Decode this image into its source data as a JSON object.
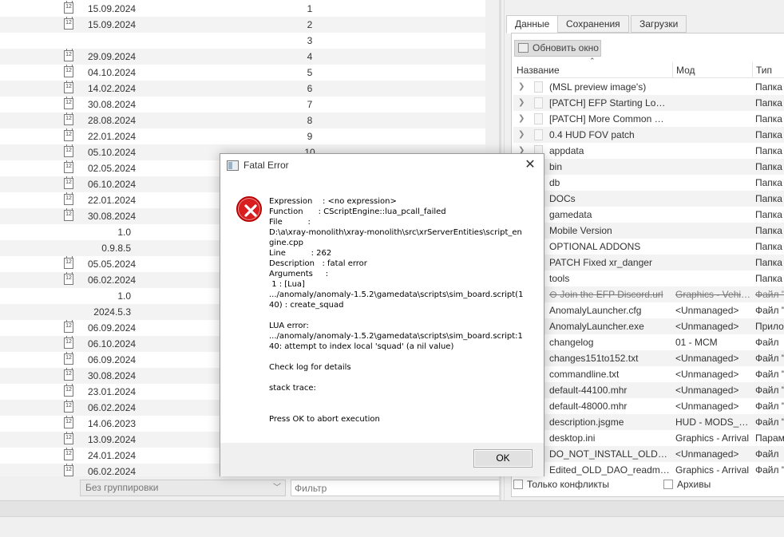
{
  "left_list": {
    "rows": [
      {
        "icon": true,
        "date": "15.09.2024",
        "version": "",
        "num": "1"
      },
      {
        "icon": true,
        "date": "15.09.2024",
        "version": "",
        "num": "2"
      },
      {
        "icon": false,
        "date": "",
        "version": "",
        "num": "3"
      },
      {
        "icon": true,
        "date": "29.09.2024",
        "version": "",
        "num": "4"
      },
      {
        "icon": true,
        "date": "04.10.2024",
        "version": "",
        "num": "5"
      },
      {
        "icon": true,
        "date": "14.02.2024",
        "version": "",
        "num": "6"
      },
      {
        "icon": true,
        "date": "30.08.2024",
        "version": "",
        "num": "7"
      },
      {
        "icon": true,
        "date": "28.08.2024",
        "version": "",
        "num": "8"
      },
      {
        "icon": true,
        "date": "22.01.2024",
        "version": "",
        "num": "9"
      },
      {
        "icon": true,
        "date": "05.10.2024",
        "version": "",
        "num": "10"
      },
      {
        "icon": true,
        "date": "02.05.2024",
        "version": "",
        "num": ""
      },
      {
        "icon": true,
        "date": "06.10.2024",
        "version": "",
        "num": ""
      },
      {
        "icon": true,
        "date": "22.01.2024",
        "version": "",
        "num": ""
      },
      {
        "icon": true,
        "date": "30.08.2024",
        "version": "",
        "num": ""
      },
      {
        "icon": false,
        "date": "",
        "version": "1.0",
        "num": ""
      },
      {
        "icon": false,
        "date": "",
        "version": "0.9.8.5",
        "num": ""
      },
      {
        "icon": true,
        "date": "05.05.2024",
        "version": "",
        "num": ""
      },
      {
        "icon": true,
        "date": "06.02.2024",
        "version": "",
        "num": ""
      },
      {
        "icon": false,
        "date": "",
        "version": "1.0",
        "num": ""
      },
      {
        "icon": false,
        "date": "",
        "version": "2024.5.3",
        "num": ""
      },
      {
        "icon": true,
        "date": "06.09.2024",
        "version": "",
        "num": ""
      },
      {
        "icon": true,
        "date": "06.10.2024",
        "version": "",
        "num": ""
      },
      {
        "icon": true,
        "date": "06.09.2024",
        "version": "",
        "num": ""
      },
      {
        "icon": true,
        "date": "30.08.2024",
        "version": "",
        "num": ""
      },
      {
        "icon": true,
        "date": "23.01.2024",
        "version": "",
        "num": ""
      },
      {
        "icon": true,
        "date": "06.02.2024",
        "version": "",
        "num": ""
      },
      {
        "icon": true,
        "date": "14.06.2023",
        "version": "",
        "num": ""
      },
      {
        "icon": true,
        "date": "13.09.2024",
        "version": "",
        "num": ""
      },
      {
        "icon": true,
        "date": "24.01.2024",
        "version": "",
        "num": ""
      },
      {
        "icon": true,
        "date": "06.02.2024",
        "version": "",
        "num": ""
      }
    ],
    "calendar_icon_text": "12",
    "grouping_value": "Без группировки",
    "filter_placeholder": "Фильтр"
  },
  "right_pane": {
    "tabs": [
      "Данные",
      "Сохранения",
      "Загрузки"
    ],
    "refresh_label": "Обновить окно",
    "columns": [
      "Название",
      "Мод",
      "Тип"
    ],
    "rows": [
      {
        "expandable": true,
        "name": "(MSL preview image's)",
        "mod": "",
        "type": "Папка",
        "strike": false
      },
      {
        "expandable": true,
        "name": "[PATCH] EFP Starting Loadouts",
        "mod": "",
        "type": "Папка",
        "strike": false
      },
      {
        "expandable": true,
        "name": "[PATCH] More Common Repair Kits",
        "mod": "",
        "type": "Папка",
        "strike": false
      },
      {
        "expandable": true,
        "name": "0.4 HUD FOV patch",
        "mod": "",
        "type": "Папка",
        "strike": false
      },
      {
        "expandable": true,
        "name": "appdata",
        "mod": "",
        "type": "Папка",
        "strike": false
      },
      {
        "expandable": true,
        "name": "bin",
        "mod": "",
        "type": "Папка",
        "strike": false
      },
      {
        "expandable": true,
        "name": "db",
        "mod": "",
        "type": "Папка",
        "strike": false
      },
      {
        "expandable": true,
        "name": "DOCs",
        "mod": "",
        "type": "Папка",
        "strike": false
      },
      {
        "expandable": true,
        "name": "gamedata",
        "mod": "",
        "type": "Папка",
        "strike": false
      },
      {
        "expandable": true,
        "name": "Mobile Version",
        "mod": "",
        "type": "Папка",
        "strike": false
      },
      {
        "expandable": true,
        "name": "OPTIONAL ADDONS",
        "mod": "",
        "type": "Папка",
        "strike": false
      },
      {
        "expandable": true,
        "name": "PATCH Fixed xr_danger",
        "mod": "",
        "type": "Папка",
        "strike": false
      },
      {
        "expandable": true,
        "name": "tools",
        "mod": "",
        "type": "Папка",
        "strike": false
      },
      {
        "expandable": false,
        "name": "⊖ Join the EFP Discord.url",
        "mod": "Graphics - Vehicles",
        "type": "Файл \"",
        "strike": true
      },
      {
        "expandable": false,
        "name": "AnomalyLauncher.cfg",
        "mod": "<Unmanaged>",
        "type": "Файл \"",
        "strike": false
      },
      {
        "expandable": false,
        "name": "AnomalyLauncher.exe",
        "mod": "<Unmanaged>",
        "type": "Прилож",
        "strike": false
      },
      {
        "expandable": false,
        "name": "changelog",
        "mod": "01 - MCM",
        "type": "Файл",
        "strike": false
      },
      {
        "expandable": false,
        "name": "changes151to152.txt",
        "mod": "<Unmanaged>",
        "type": "Файл \"",
        "strike": false
      },
      {
        "expandable": false,
        "name": "commandline.txt",
        "mod": "<Unmanaged>",
        "type": "Файл \"",
        "strike": false
      },
      {
        "expandable": false,
        "name": "default-44100.mhr",
        "mod": "<Unmanaged>",
        "type": "Файл \"",
        "strike": false
      },
      {
        "expandable": false,
        "name": "default-48000.mhr",
        "mod": "<Unmanaged>",
        "type": "Файл \"",
        "strike": false
      },
      {
        "expandable": false,
        "name": "description.jsgme",
        "mod": "HUD - MODS_Addons",
        "type": "Файл \"",
        "strike": false
      },
      {
        "expandable": false,
        "name": "desktop.ini",
        "mod": "Graphics - Arrival",
        "type": "Парам",
        "strike": false
      },
      {
        "expandable": false,
        "name": "DO_NOT_INSTALL_OLD_ADDONS",
        "mod": "<Unmanaged>",
        "type": "Файл",
        "strike": false
      },
      {
        "expandable": false,
        "name": "Edited_OLD_DAO_readme.txt",
        "mod": "Graphics - Arrival",
        "type": "Файл \"",
        "strike": false
      }
    ],
    "only_conflicts_label": "Только конфликты",
    "archives_label": "Архивы"
  },
  "dialog": {
    "title": "Fatal Error",
    "close_glyph": "✕",
    "message": "Expression    : <no expression>\nFunction      : CScriptEngine::lua_pcall_failed\nFile          :\nD:\\a\\xray-monolith\\xray-monolith\\src\\xrServerEntities\\script_engine.cpp\nLine          : 262\nDescription   : fatal error\nArguments     :\n 1 : [Lua]\n.../anomaly/anomaly-1.5.2\\gamedata\\scripts\\sim_board.script(140) : create_squad\n\nLUA error:\n.../anomaly/anomaly-1.5.2\\gamedata\\scripts\\sim_board.script:140: attempt to index local 'squad' (a nil value)\n\nCheck log for details\n\nstack trace:\n\n\nPress OK to abort execution",
    "ok_label": "OK"
  }
}
